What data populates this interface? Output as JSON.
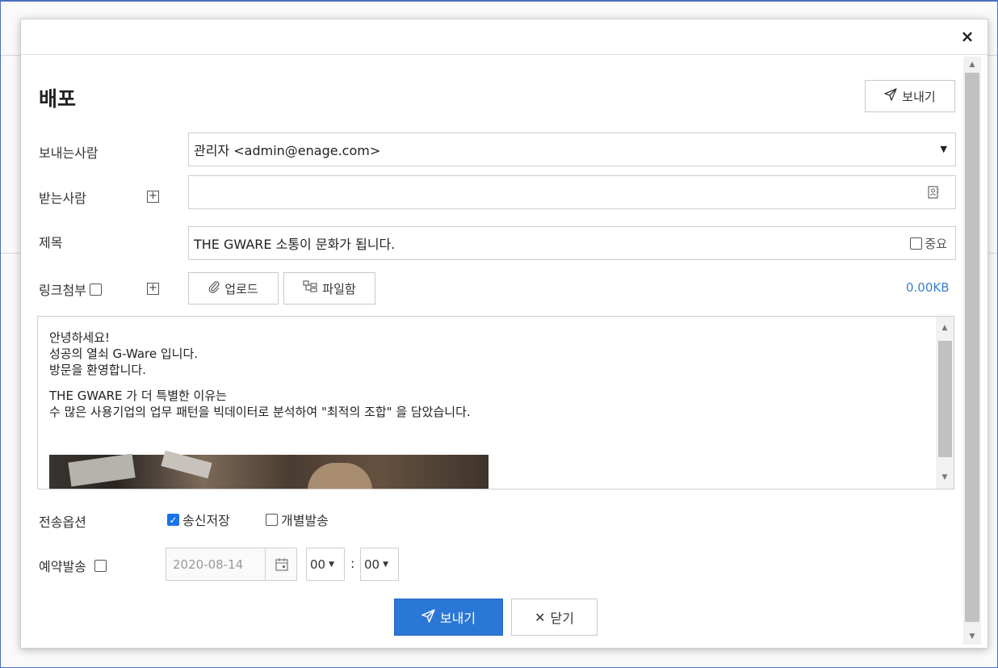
{
  "dialog": {
    "title": "배포",
    "close_icon": "×",
    "top_send_label": "보내기"
  },
  "form": {
    "sender": {
      "label": "보내는사람",
      "value": "관리자 <admin@enage.com>"
    },
    "recipient": {
      "label": "받는사람",
      "value": ""
    },
    "subject": {
      "label": "제목",
      "value": "THE GWARE 소통이 문화가 됩니다.",
      "important_label": "중요",
      "important_checked": false
    },
    "attachment": {
      "label": "링크첨부",
      "upload_label": "업로드",
      "filebox_label": "파일함",
      "size": "0.00KB"
    }
  },
  "editor": {
    "lines_group1": [
      "안녕하세요!",
      "성공의 열쇠 G-Ware 입니다.",
      "방문을 환영합니다."
    ],
    "lines_group2": [
      "THE GWARE 가 더 특별한 이유는",
      "수 많은 사용기업의 업무 패턴을 빅데이터로 분석하여 \"최적의 조합\" 을 담았습니다."
    ]
  },
  "options": {
    "label": "전송옵션",
    "save_sent": {
      "label": "송신저장",
      "checked": true
    },
    "individual": {
      "label": "개별발송",
      "checked": false
    }
  },
  "schedule": {
    "label": "예약발송",
    "date": "2020-08-14",
    "hour": "00",
    "minute": "00",
    "separator": ":"
  },
  "footer": {
    "send_label": "보내기",
    "close_label": "닫기"
  },
  "colors": {
    "primary": "#2b77d5",
    "link": "#3b7fd0"
  }
}
